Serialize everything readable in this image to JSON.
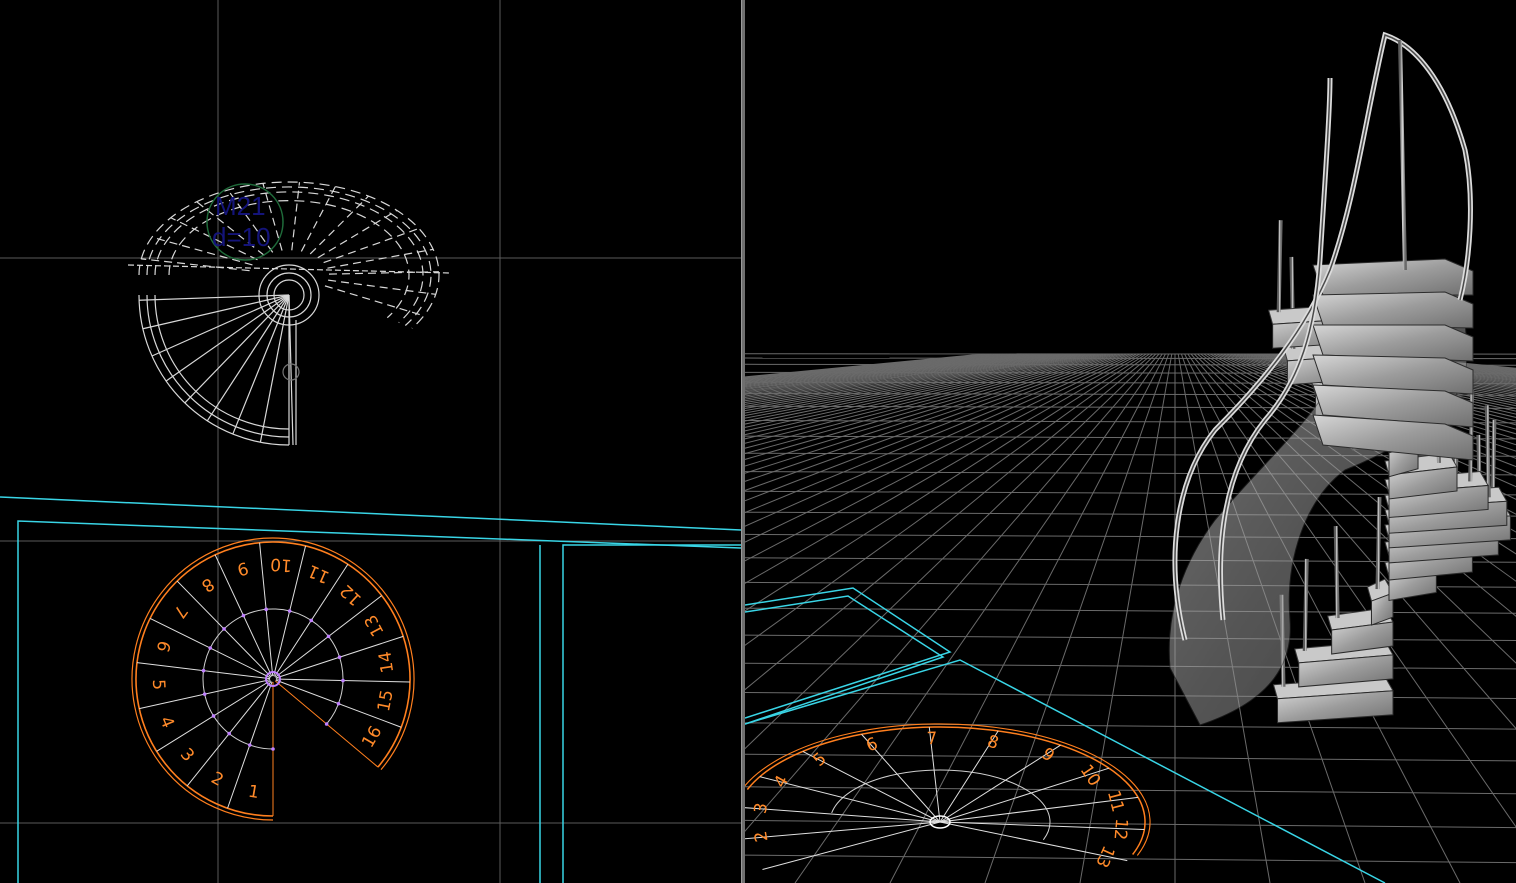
{
  "plan_view": {
    "stair_tag": {
      "label": "M21",
      "depth": "d=10"
    },
    "step_numbers": [
      "1",
      "2",
      "3",
      "4",
      "5",
      "6",
      "7",
      "8",
      "9",
      "10",
      "11",
      "12",
      "13",
      "14",
      "15",
      "16"
    ]
  },
  "perspective_view": {
    "floor_step_numbers": [
      "2",
      "3",
      "4",
      "5",
      "6",
      "7",
      "8",
      "9",
      "10",
      "11",
      "12",
      "13"
    ]
  },
  "colors": {
    "background": "#000000",
    "grid": "#5a5a5a",
    "wireframe": "#d8d8d8",
    "stair_outline": "#ff7f1e",
    "walls": "#39d5e6",
    "tag": "#14147a",
    "tag_circle": "#1f6b3a",
    "center_post": "#c080ff"
  }
}
